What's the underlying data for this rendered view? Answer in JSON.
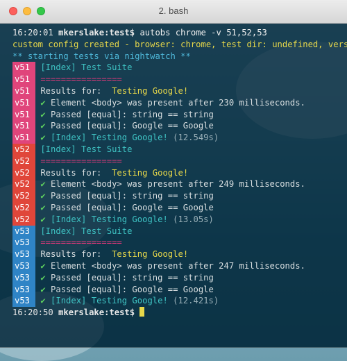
{
  "window": {
    "title": "2. bash"
  },
  "terminal": {
    "prompt_start": {
      "time": "16:20:01",
      "user": "mkerslake:test$",
      "command": "autobs chrome -v 51,52,53"
    },
    "config_line": "custom config created - browser: chrome, test dir: undefined, version",
    "starting_line": "** starting tests via nightwatch **",
    "suites": [
      {
        "tag": "v51",
        "suite_title": "[Index] Test Suite",
        "separator": "================",
        "results_label": "Results for:",
        "results_name": "Testing Google!",
        "element_line": "Element <body> was present after 230 milliseconds.",
        "passed1": "Passed [equal]: string == string",
        "passed2": "Passed [equal]: Google == Google",
        "summary_prefix": "[Index] Testing Google!",
        "summary_time": "(12.549s)"
      },
      {
        "tag": "v52",
        "suite_title": "[Index] Test Suite",
        "separator": "================",
        "results_label": "Results for:",
        "results_name": "Testing Google!",
        "element_line": "Element <body> was present after 249 milliseconds.",
        "passed1": "Passed [equal]: string == string",
        "passed2": "Passed [equal]: Google == Google",
        "summary_prefix": "[Index] Testing Google!",
        "summary_time": "(13.05s)"
      },
      {
        "tag": "v53",
        "suite_title": "[Index] Test Suite",
        "separator": "================",
        "results_label": "Results for:",
        "results_name": "Testing Google!",
        "element_line": "Element <body> was present after 247 milliseconds.",
        "passed1": "Passed [equal]: string == string",
        "passed2": "Passed [equal]: Google == Google",
        "summary_prefix": "[Index] Testing Google!",
        "summary_time": "(12.421s)"
      }
    ],
    "prompt_end": {
      "time": "16:20:50",
      "user": "mkerslake:test$"
    },
    "check_glyph": "✔"
  },
  "colors": {
    "v51": "#e0457b",
    "v52": "#e0463a",
    "v53": "#2f84c6"
  }
}
